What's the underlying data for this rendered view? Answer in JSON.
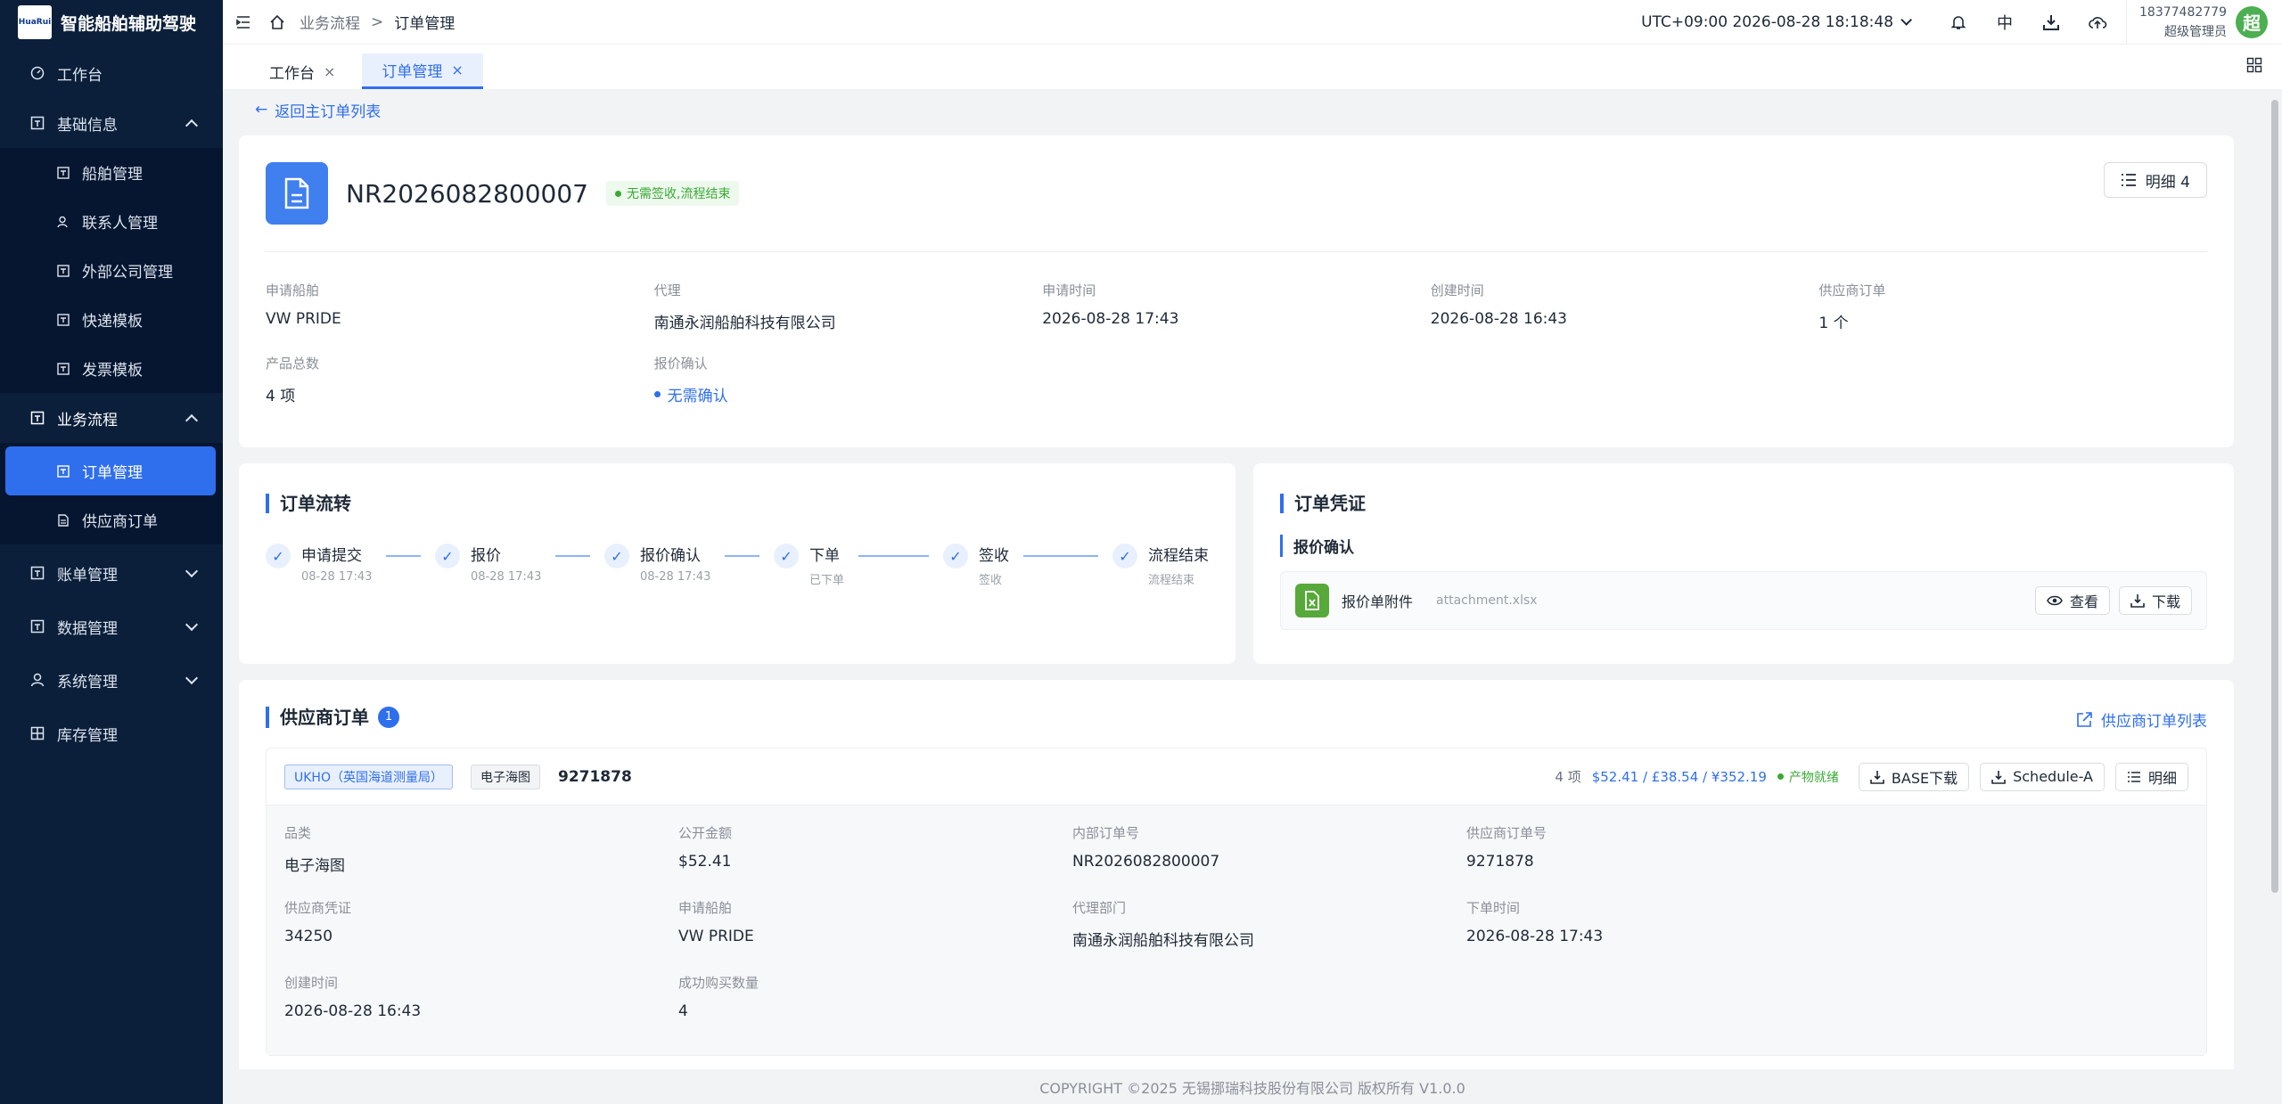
{
  "app": {
    "logo_text": "HuaRui",
    "title": "智能船舶辅助驾驶"
  },
  "sidebar": {
    "items": [
      {
        "label": "工作台",
        "icon": "dashboard-icon"
      },
      {
        "label": "基础信息",
        "icon": "info-icon",
        "expanded": true,
        "children": [
          "船舶管理",
          "联系人管理",
          "外部公司管理",
          "快递模板",
          "发票模板"
        ]
      },
      {
        "label": "业务流程",
        "icon": "flow-icon",
        "expanded": true,
        "children": [
          "订单管理",
          "供应商订单"
        ],
        "active_child": "订单管理"
      },
      {
        "label": "账单管理",
        "icon": "bill-icon"
      },
      {
        "label": "数据管理",
        "icon": "data-icon"
      },
      {
        "label": "系统管理",
        "icon": "user-icon"
      },
      {
        "label": "库存管理",
        "icon": "grid-icon"
      }
    ]
  },
  "header": {
    "breadcrumb": [
      "业务流程",
      "订单管理"
    ],
    "breadcrumb_sep": ">",
    "timezone": "UTC+09:00 2026-08-28 18:18:48",
    "lang": "中",
    "user_phone": "18377482779",
    "user_role": "超级管理员",
    "avatar_char": "超"
  },
  "tabs": [
    {
      "label": "工作台",
      "active": false
    },
    {
      "label": "订单管理",
      "active": true
    }
  ],
  "back_link": "返回主订单列表",
  "order": {
    "number": "NR2026082800007",
    "status": "无需签收,流程结束",
    "detail_button": "明细 4",
    "fields": [
      {
        "label": "申请船舶",
        "value": "VW PRIDE"
      },
      {
        "label": "代理",
        "value": "南通永润船舶科技有限公司"
      },
      {
        "label": "申请时间",
        "value": "2026-08-28 17:43"
      },
      {
        "label": "创建时间",
        "value": "2026-08-28 16:43"
      },
      {
        "label": "供应商订单",
        "value": "1 个"
      },
      {
        "label": "产品总数",
        "value": "4 项"
      },
      {
        "label": "报价确认",
        "value": "无需确认"
      }
    ]
  },
  "flow": {
    "title": "订单流转",
    "steps": [
      {
        "name": "申请提交",
        "sub": "08-28 17:43"
      },
      {
        "name": "报价",
        "sub": "08-28 17:43"
      },
      {
        "name": "报价确认",
        "sub": "08-28 17:43"
      },
      {
        "name": "下单",
        "sub": "已下单"
      },
      {
        "name": "签收",
        "sub": "签收"
      },
      {
        "name": "流程结束",
        "sub": "流程结束"
      }
    ]
  },
  "voucher": {
    "title": "订单凭证",
    "subtitle": "报价确认",
    "attachment_name": "报价单附件",
    "attachment_file": "attachment.xlsx",
    "view_label": "查看",
    "download_label": "下载"
  },
  "supplier": {
    "title": "供应商订单",
    "count": "1",
    "list_link": "供应商订单列表",
    "tag_supplier": "UKHO（英国海道测量局）",
    "tag_type": "电子海图",
    "order_no": "9271878",
    "summary": "4 项",
    "price": "$52.41 / £38.54 / ¥352.19",
    "ready": "产物就绪",
    "btn_base": "BASE下载",
    "btn_schedule": "Schedule-A",
    "btn_detail": "明细",
    "fields": [
      {
        "label": "品类",
        "value": "电子海图"
      },
      {
        "label": "公开金额",
        "value": "$52.41"
      },
      {
        "label": "内部订单号",
        "value": "NR2026082800007"
      },
      {
        "label": "供应商订单号",
        "value": "9271878"
      },
      {
        "label": "供应商凭证",
        "value": "34250"
      },
      {
        "label": "申请船舶",
        "value": "VW PRIDE"
      },
      {
        "label": "代理部门",
        "value": "南通永润船舶科技有限公司"
      },
      {
        "label": "下单时间",
        "value": "2026-08-28 17:43"
      },
      {
        "label": "创建时间",
        "value": "2026-08-28 16:43"
      },
      {
        "label": "成功购买数量",
        "value": "4"
      }
    ]
  },
  "footer": "COPYRIGHT ©2025 无锡挪瑞科技股份有限公司 版权所有 V1.0.0",
  "colors": {
    "sidebar_bg": "#0b1f3a",
    "accent": "#2f6fed",
    "success": "#3aaa35"
  }
}
